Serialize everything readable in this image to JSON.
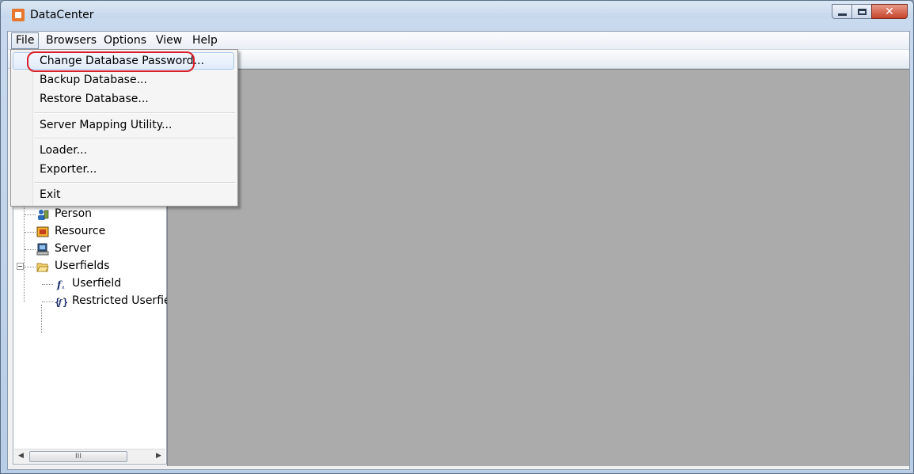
{
  "window": {
    "title": "DataCenter"
  },
  "menubar": {
    "items": [
      {
        "label": "File"
      },
      {
        "label": "Browsers"
      },
      {
        "label": "Options"
      },
      {
        "label": "View"
      },
      {
        "label": "Help"
      }
    ]
  },
  "file_menu": {
    "items": [
      {
        "label": "Change Database Password..."
      },
      {
        "label": "Backup Database..."
      },
      {
        "label": "Restore Database..."
      },
      {
        "label": "Server Mapping Utility..."
      },
      {
        "label": "Loader..."
      },
      {
        "label": "Exporter..."
      },
      {
        "label": "Exit"
      }
    ],
    "highlighted": "Change Database Password..."
  },
  "tree": {
    "items": [
      {
        "label": "Person",
        "icon": "person-icon"
      },
      {
        "label": "Resource",
        "icon": "resource-icon"
      },
      {
        "label": "Server",
        "icon": "server-icon"
      },
      {
        "label": "Userfields",
        "icon": "folder-open-icon",
        "expanded": true
      },
      {
        "label": "Userfield",
        "icon": "function-icon"
      },
      {
        "label": "Restricted Userfiel",
        "icon": "restricted-function-icon"
      }
    ]
  },
  "scrollbar": {
    "thumb_grip": "III"
  },
  "annotation": {
    "color": "#d81f2a"
  }
}
